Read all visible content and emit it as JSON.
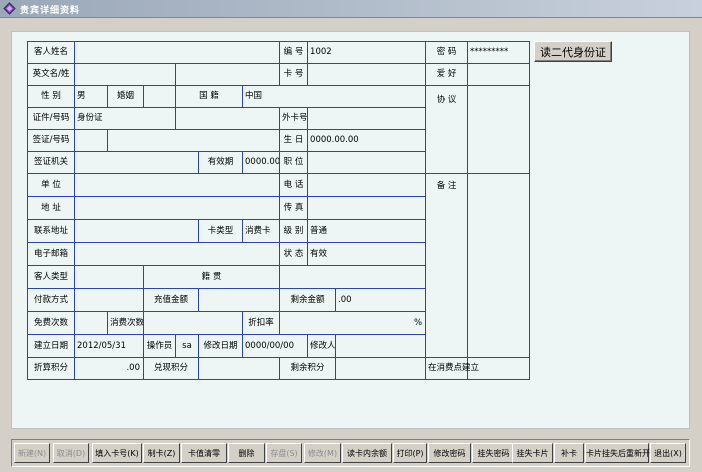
{
  "window": {
    "title": "贵宾详细资料"
  },
  "form": {
    "guest_name_label": "客人姓名",
    "guest_name_value": "",
    "number_label": "编  号",
    "number_value": "1002",
    "password_label": "密  码",
    "password_value": "*********",
    "english_name_label": "英文名/姓",
    "card_no_label": "卡  号",
    "hobby_label": "爱  好",
    "gender_label": "性    别",
    "gender_value": "男",
    "marriage_label": "婚姻",
    "nationality_label": "国  籍",
    "nationality_value": "中国",
    "agreement_label": "协  议",
    "id_type_label": "证件/号码",
    "id_type_value": "身份证",
    "foreign_card_label": "外卡号",
    "visa_label": "签证/号码",
    "birthday_label": "生  日",
    "birthday_value": "0000.00.00",
    "visa_office_label": "签证机关",
    "valid_period_label": "有效期",
    "valid_period_value": "0000.00.00",
    "position_label": "职  位",
    "remark_label": "备  注",
    "company_label": "单    位",
    "phone_label": "电  话",
    "address_label": "地    址",
    "fax_label": "传  真",
    "contact_address_label": "联系地址",
    "card_type_label": "卡类型",
    "card_type_value": "消费卡",
    "level_label": "级  别",
    "level_value": "普通",
    "email_label": "电子邮箱",
    "status_label": "状  态",
    "status_value": "有效",
    "guest_type_label": "客人类型",
    "origin_label": "籍    贯",
    "payment_label": "付款方式",
    "recharge_label": "充值金额",
    "balance_label": "剩余金额",
    "balance_value": ".00",
    "free_times_label": "免费次数",
    "consume_times_label": "消费次数",
    "discount_label": "折扣率",
    "discount_unit": "%",
    "create_date_label": "建立日期",
    "create_date_value": "2012/05/31",
    "operator_label": "操作员",
    "operator_value": "sa",
    "modify_date_label": "修改日期",
    "modify_date_value": "0000/00/00",
    "modifier_label": "修改人",
    "points_label": "折算积分",
    "points_value": ".00",
    "redeem_points_label": "兑现积分",
    "remain_points_label": "剩余积分",
    "created_at_store_label": "在消费点建立"
  },
  "read_id_button": "读二代身份证",
  "buttons": [
    {
      "label": "新建(N)",
      "disabled": true
    },
    {
      "label": "取消(D)",
      "disabled": true
    },
    {
      "label": "填入卡号(K)",
      "disabled": false
    },
    {
      "label": "制卡(Z)",
      "disabled": false
    },
    {
      "label": "卡值清零",
      "disabled": false
    },
    {
      "label": "删除",
      "disabled": false
    },
    {
      "label": "存盘(S)",
      "disabled": true
    },
    {
      "label": "修改(M)",
      "disabled": true
    },
    {
      "label": "读卡内余额",
      "disabled": false
    },
    {
      "label": "打印(P)",
      "disabled": false
    },
    {
      "label": "修改密码",
      "disabled": false
    },
    {
      "label": "挂失密码",
      "disabled": false
    },
    {
      "label": "挂失卡片",
      "disabled": false
    },
    {
      "label": "补卡",
      "disabled": false
    },
    {
      "label": "卡片挂失后重新开通",
      "disabled": false
    },
    {
      "label": "退出(X)",
      "disabled": false
    }
  ]
}
